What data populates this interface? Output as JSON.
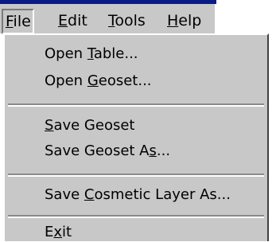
{
  "menubar": {
    "items": [
      {
        "label": "File",
        "mnemonic": "F"
      },
      {
        "label": "Edit",
        "mnemonic": "E"
      },
      {
        "label": "Tools",
        "mnemonic": "T"
      },
      {
        "label": "Help",
        "mnemonic": "H"
      }
    ]
  },
  "file_menu": {
    "items": [
      {
        "label": "Open Table..."
      },
      {
        "label": "Open Geoset..."
      },
      {
        "label": "Save Geoset"
      },
      {
        "label": "Save Geoset As..."
      },
      {
        "label": "Save Cosmetic Layer As..."
      },
      {
        "label": "Exit"
      }
    ]
  },
  "colors": {
    "menu_background": "#c8c8c8",
    "titlebar": "#0a1a86"
  }
}
